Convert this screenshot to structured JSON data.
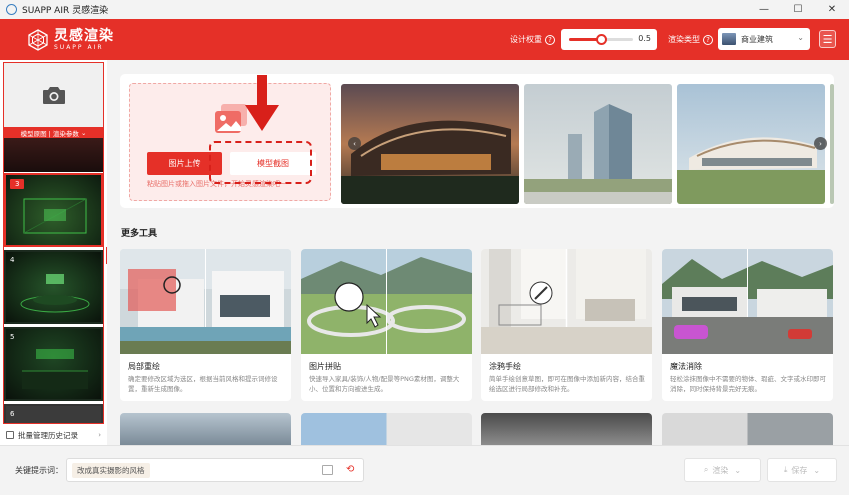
{
  "window": {
    "title": "SUAPP AIR 灵感渲染",
    "minimize": "—",
    "maximize": "☐",
    "close": "✕"
  },
  "header": {
    "logo_cn": "灵感渲染",
    "logo_en": "SUAPP AIR",
    "design_weight_label": "设计权重",
    "design_weight_value": "0.5",
    "design_weight_fraction": 0.5,
    "render_type_label": "渲染类型",
    "render_type_value": "商业建筑",
    "menu_icon": "☰"
  },
  "sidebar": {
    "model_tab": "模型原图 | 渲染参数",
    "items": [
      {
        "num": "3",
        "active": true
      },
      {
        "num": "4",
        "active": false
      },
      {
        "num": "5",
        "active": false
      },
      {
        "num": "6",
        "active": false
      }
    ],
    "history_label": "批量管理历史记录",
    "collapse_icon": "◀"
  },
  "upload": {
    "upload_button": "图片上传",
    "screenshot_button": "模型截图",
    "hint": "粘贴图片或拖入图片文件，开始灵感渲染吧~"
  },
  "gallery": {
    "prev": "‹",
    "next": "›"
  },
  "more_tools": {
    "title": "更多工具",
    "cards": [
      {
        "name": "局部重绘",
        "desc": "确定要修改区域为选区，根据当前风格和提示词修设置，重新生成图像。"
      },
      {
        "name": "图片拼贴",
        "desc": "快速导入家具/装饰/人物/配景等PNG素材图，调整大小、位置和方向被进生成。"
      },
      {
        "name": "涂鸦手绘",
        "desc": "简单手绘创意草图，即可在图像中添加新内容，结合重绘选区进行局部修改和补充。"
      },
      {
        "name": "魔法消除",
        "desc": "轻松涂抹图像中不需要的物体、瑕疵、文字或水印即可消除，同时保持背景完好无痕。"
      }
    ]
  },
  "bottom": {
    "keywords_label": "关键提示词：",
    "keyword_tag": "改成真实摄影的风格",
    "render_button": "渲染",
    "save_button": "保存"
  },
  "colors": {
    "brand_red": "#e53028",
    "hint_red": "#e86e68"
  }
}
